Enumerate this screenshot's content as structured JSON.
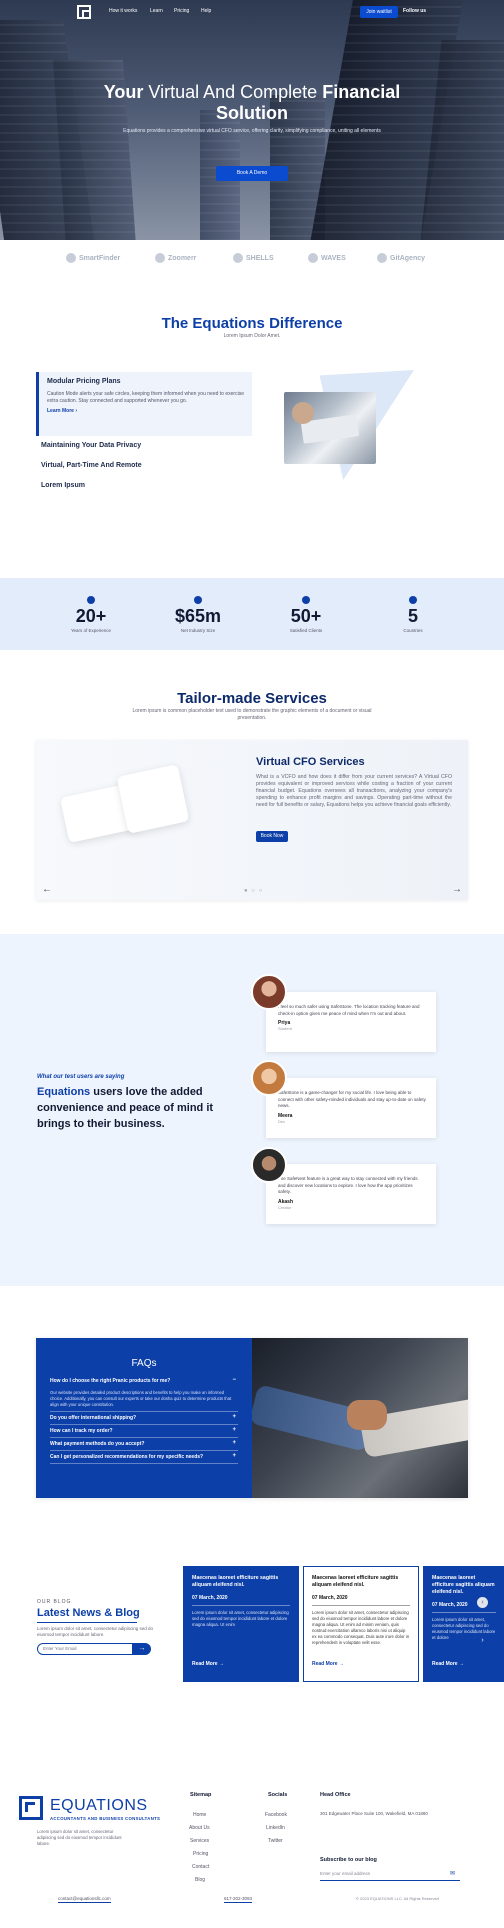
{
  "nav": {
    "links": [
      "How it works",
      "Learn",
      "Pricing",
      "Help"
    ],
    "join_label": "Join waitlist",
    "follow_label": "Follow us"
  },
  "hero": {
    "title_b1": "Your",
    "title_mid": " Virtual And Complete ",
    "title_b2": "Financial",
    "title_b3": "Solution",
    "subtitle": "Equations provides a comprehensive virtual CFO service, offering clarity, simplifying compliance, uniting all elements",
    "cta": "Book A Demo"
  },
  "clients": [
    "SmartFinder",
    "Zoomerr",
    "SHELLS",
    "WAVES",
    "GitAgency"
  ],
  "difference": {
    "title": "The Equations Difference",
    "subtitle": "Lorem Ipsum Dolor Amet.",
    "active": {
      "title": "Modular Pricing Plans",
      "body": "Caution Mode alerts your safe circles, keeping them informed when you need to exercise extra caution. Stay connected and supported whenever you go.",
      "link": "Learn More"
    },
    "items": [
      "Maintaining Your Data Privacy",
      "Virtual, Part-Time And Remote",
      "Lorem Ipsum"
    ]
  },
  "stats": [
    {
      "value": "20+",
      "label": "Years of Experience"
    },
    {
      "value": "$65m",
      "label": "Net Industry Size"
    },
    {
      "value": "50+",
      "label": "Satisfied Clients"
    },
    {
      "value": "5",
      "label": "Countries"
    }
  ],
  "services": {
    "title": "Tailor-made Services",
    "subtitle": "Lorem ipsum is common placeholder text used to demonstrate the graphic elements of a document or visual presentation.",
    "card_title": "Virtual CFO Services",
    "card_body": "What is a VCFO and how does it differ from your current services? A Virtual CFO provides equivalent or improved services while costing a fraction of your current financial budget. Equations oversees all transactions, analyzing your company's spending to enhance profit margins and savings. Operating part-time without the need for full benefits or salary, Equations helps you achieve financial goals efficiently.",
    "card_cta": "Book Now",
    "prev": "←",
    "next": "→"
  },
  "testimonials": {
    "eyebrow": "What our test users are saying",
    "heading_hl": "Equations",
    "heading_rest": " users love the added convenience and peace of mind it brings to their business.",
    "items": [
      {
        "quote": "I feel so much safer using SafeStone. The location tracking feature and check-in option gives me peace of mind when I'm out and about.",
        "name": "Priya",
        "role": "Student"
      },
      {
        "quote": "SafeStone is a game-changer for my social life. I love being able to connect with other safety-minded individuals and stay up-to-date on safety news.",
        "name": "Meera",
        "role": "Dev"
      },
      {
        "quote": "The SafeNest feature is a great way to stay connected with my friends and discover new locations to explore. I love how the app prioritizes safety.",
        "name": "Akash",
        "role": "Creator"
      }
    ]
  },
  "faq": {
    "title": "FAQs",
    "open_q": "How do I choose the right Pranic products for me?",
    "open_a": "Our website provides detailed product descriptions and benefits to help you make an informed choice. Additionally, you can consult our experts or take our dosha quiz to determine products that align with your unique constitution.",
    "questions": [
      "Do you offer international shipping?",
      "How can I track my order?",
      "What payment methods do you accept?",
      "Can I get personalized recommendations for my specific needs?"
    ]
  },
  "blog": {
    "eyebrow": "OUR BLOG",
    "title": "Latest News & Blog",
    "subtitle": "Lorem ipsum dolor sit amet, consectetur adipiscing sed do eiusmod tempor incididunt labore.",
    "input_placeholder": "Enter Your Email",
    "posts": [
      {
        "title": "Maecenas laoreet efficiture sagittis aliquam eleifend nisl.",
        "date": "07 March, 2020",
        "body": "Lorem ipsum dolor sit amet, consectetur adipiscing sed do eiusmod tempor incididunt labore et dolore magna aliqua. Ut enim",
        "more": "Read More →"
      },
      {
        "title": "Maecenas laoreet efficiture sagittis aliquam eleifend nisl.",
        "date": "07 March, 2020",
        "body": "Lorem ipsum dolor sit amet, consectetur adipiscing sed do eiusmod tempor incididunt labore et dolore magna aliqua. Ut enim ad minim veniam, quis nostrud exercitation ullamco laboris nisi ut aliquip ex ea commodo consequat. Duis aute irure dolor in reprehenderit in voluptate velit esse.",
        "more": "Read More →"
      },
      {
        "title": "Maecenas laoreet efficiture sagittis aliquam eleifend nisl.",
        "date": "07 March, 2020",
        "body": "Lorem ipsum dolor sit amet, consectetur adipiscing sed do eiusmod tempor incididunt labore et dolore",
        "more": "Read More →"
      }
    ]
  },
  "footer": {
    "brand": "EQUATIONS",
    "tagline": "ACCOUNTANTS AND BUSINESS CONSULTANTS",
    "desc": "Lorem ipsum dolor sit amet, consectetur adipiscing sed do eiusmod tempor incididunt labore.",
    "sitemap_head": "Sitemap",
    "sitemap": [
      "Home",
      "About Us",
      "Services",
      "Pricing",
      "Contact",
      "Blog"
    ],
    "socials_head": "Socials",
    "socials": [
      "Facebook",
      "LinkedIn",
      "Twitter"
    ],
    "office_head": "Head Office",
    "address": "301 Edgewater Place Suite 100, Wakefield, MA 01880",
    "subscribe_head": "Subscribe to our blog",
    "email_placeholder": "Enter your email address",
    "email": "contact@equationsllc.com",
    "phone": "617-202-3093",
    "copyright": "© 2023 EQUATIONS LLC. All Rights Reserved"
  }
}
